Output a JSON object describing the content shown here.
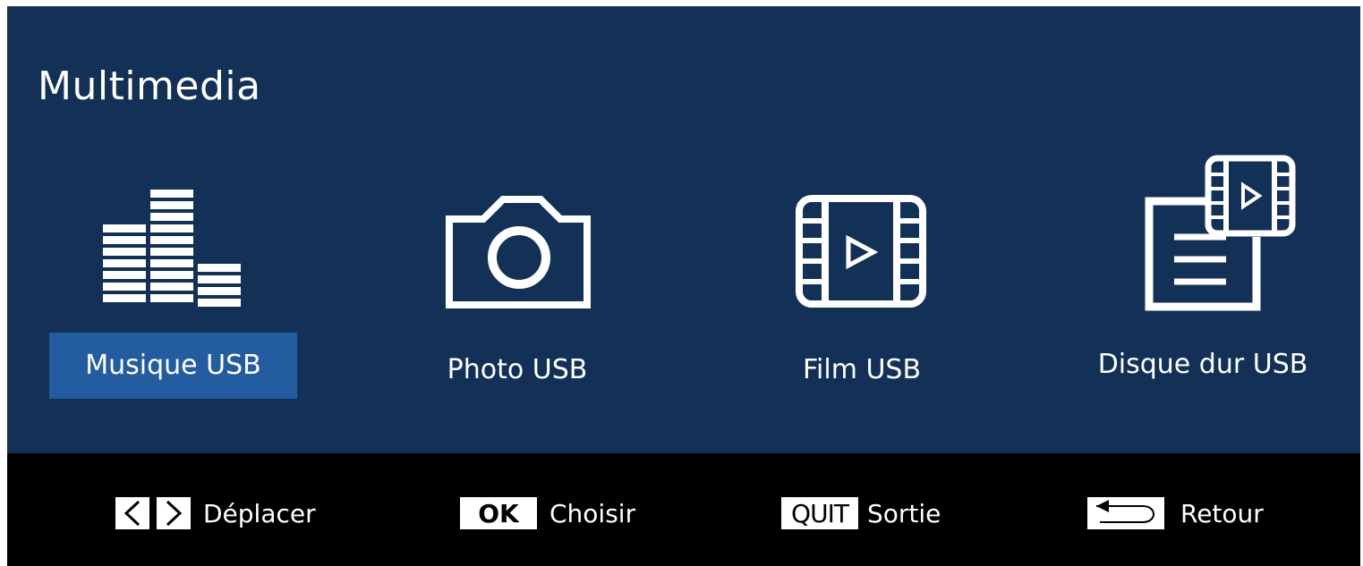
{
  "screen": {
    "title": "Multimedia"
  },
  "menu": {
    "items": [
      {
        "label": "Musique USB",
        "icon": "equalizer-icon",
        "selected": true
      },
      {
        "label": "Photo USB",
        "icon": "camera-icon",
        "selected": false
      },
      {
        "label": "Film USB",
        "icon": "film-icon",
        "selected": false
      },
      {
        "label": "Disque dur USB",
        "icon": "hard-drive-media-icon",
        "selected": false
      }
    ]
  },
  "footer": {
    "hints": [
      {
        "key": "arrow-keys-icon",
        "label": "Déplacer"
      },
      {
        "key": "OK",
        "label": "Choisir"
      },
      {
        "key": "QUIT",
        "label": "Sortie"
      },
      {
        "key": "return-arrow-icon",
        "label": "Retour"
      }
    ]
  },
  "colors": {
    "panel_background": "#133157",
    "selection_highlight": "#245d9f",
    "footer_background": "#000000",
    "text": "#ffffff"
  }
}
